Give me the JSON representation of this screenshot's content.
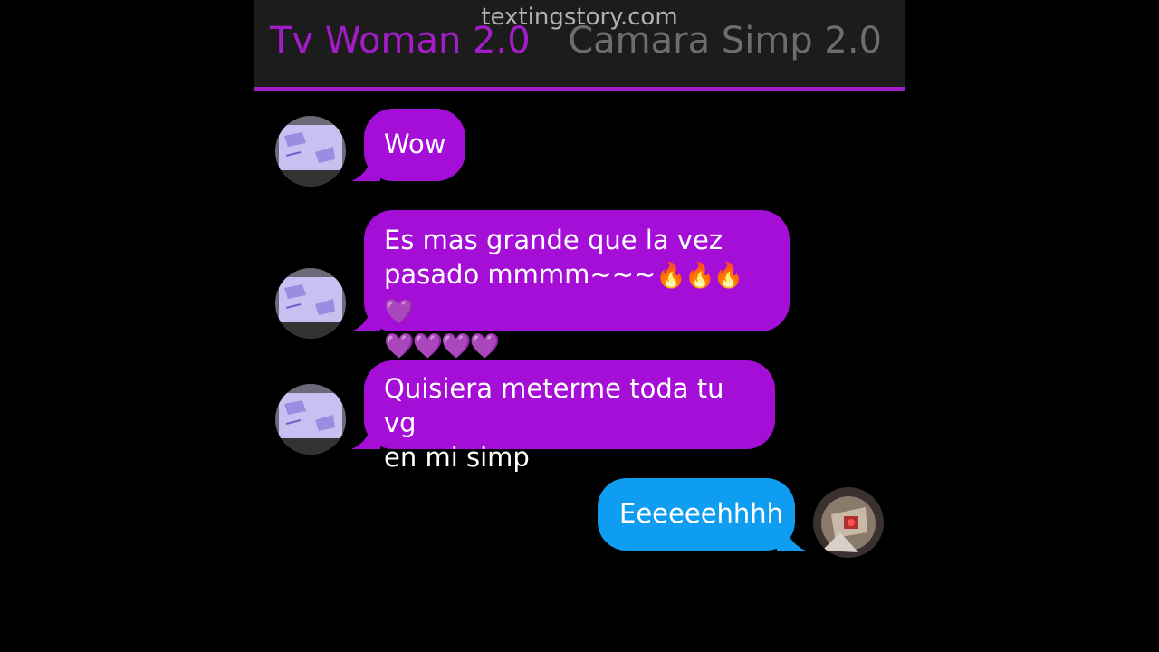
{
  "watermark": "textingstory.com",
  "header": {
    "left_name": "Tv Woman 2.0",
    "right_name": "Camara Simp 2.0"
  },
  "colors": {
    "incoming_bubble": "#a40ed6",
    "outgoing_bubble": "#0e9df0",
    "accent": "#a21cc9"
  },
  "messages": [
    {
      "sender": "Tv Woman 2.0",
      "text": "Wow"
    },
    {
      "sender": "Tv Woman 2.0",
      "line1": "Es mas grande que la vez",
      "line2": "pasado mmmm~~~",
      "emoji_line2": "🔥🔥🔥💜",
      "emoji_line3": "💜💜💜💜"
    },
    {
      "sender": "Tv Woman 2.0",
      "line1": "Quisiera meterme toda tu vg",
      "line2": "en mi simp"
    },
    {
      "sender": "Camara Simp 2.0",
      "text": "Eeeeeehhhh"
    }
  ]
}
